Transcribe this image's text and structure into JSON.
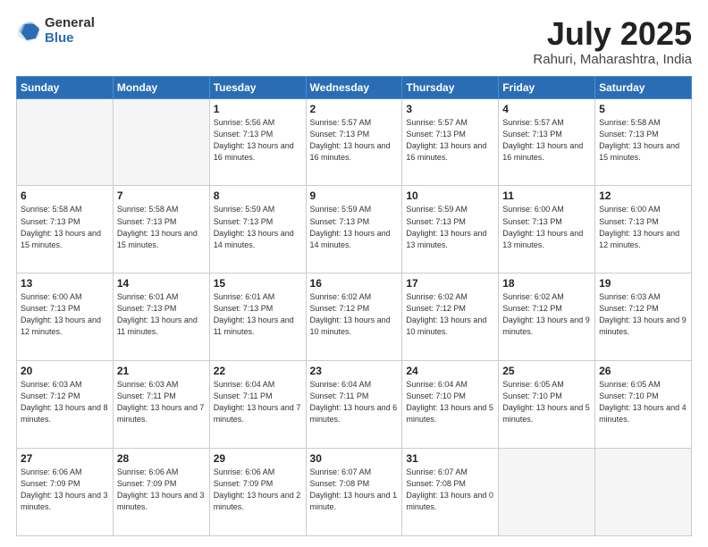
{
  "header": {
    "logo_general": "General",
    "logo_blue": "Blue",
    "title": "July 2025",
    "location": "Rahuri, Maharashtra, India"
  },
  "weekdays": [
    "Sunday",
    "Monday",
    "Tuesday",
    "Wednesday",
    "Thursday",
    "Friday",
    "Saturday"
  ],
  "weeks": [
    [
      {
        "day": "",
        "info": ""
      },
      {
        "day": "",
        "info": ""
      },
      {
        "day": "1",
        "info": "Sunrise: 5:56 AM\nSunset: 7:13 PM\nDaylight: 13 hours\nand 16 minutes."
      },
      {
        "day": "2",
        "info": "Sunrise: 5:57 AM\nSunset: 7:13 PM\nDaylight: 13 hours\nand 16 minutes."
      },
      {
        "day": "3",
        "info": "Sunrise: 5:57 AM\nSunset: 7:13 PM\nDaylight: 13 hours\nand 16 minutes."
      },
      {
        "day": "4",
        "info": "Sunrise: 5:57 AM\nSunset: 7:13 PM\nDaylight: 13 hours\nand 16 minutes."
      },
      {
        "day": "5",
        "info": "Sunrise: 5:58 AM\nSunset: 7:13 PM\nDaylight: 13 hours\nand 15 minutes."
      }
    ],
    [
      {
        "day": "6",
        "info": "Sunrise: 5:58 AM\nSunset: 7:13 PM\nDaylight: 13 hours\nand 15 minutes."
      },
      {
        "day": "7",
        "info": "Sunrise: 5:58 AM\nSunset: 7:13 PM\nDaylight: 13 hours\nand 15 minutes."
      },
      {
        "day": "8",
        "info": "Sunrise: 5:59 AM\nSunset: 7:13 PM\nDaylight: 13 hours\nand 14 minutes."
      },
      {
        "day": "9",
        "info": "Sunrise: 5:59 AM\nSunset: 7:13 PM\nDaylight: 13 hours\nand 14 minutes."
      },
      {
        "day": "10",
        "info": "Sunrise: 5:59 AM\nSunset: 7:13 PM\nDaylight: 13 hours\nand 13 minutes."
      },
      {
        "day": "11",
        "info": "Sunrise: 6:00 AM\nSunset: 7:13 PM\nDaylight: 13 hours\nand 13 minutes."
      },
      {
        "day": "12",
        "info": "Sunrise: 6:00 AM\nSunset: 7:13 PM\nDaylight: 13 hours\nand 12 minutes."
      }
    ],
    [
      {
        "day": "13",
        "info": "Sunrise: 6:00 AM\nSunset: 7:13 PM\nDaylight: 13 hours\nand 12 minutes."
      },
      {
        "day": "14",
        "info": "Sunrise: 6:01 AM\nSunset: 7:13 PM\nDaylight: 13 hours\nand 11 minutes."
      },
      {
        "day": "15",
        "info": "Sunrise: 6:01 AM\nSunset: 7:13 PM\nDaylight: 13 hours\nand 11 minutes."
      },
      {
        "day": "16",
        "info": "Sunrise: 6:02 AM\nSunset: 7:12 PM\nDaylight: 13 hours\nand 10 minutes."
      },
      {
        "day": "17",
        "info": "Sunrise: 6:02 AM\nSunset: 7:12 PM\nDaylight: 13 hours\nand 10 minutes."
      },
      {
        "day": "18",
        "info": "Sunrise: 6:02 AM\nSunset: 7:12 PM\nDaylight: 13 hours\nand 9 minutes."
      },
      {
        "day": "19",
        "info": "Sunrise: 6:03 AM\nSunset: 7:12 PM\nDaylight: 13 hours\nand 9 minutes."
      }
    ],
    [
      {
        "day": "20",
        "info": "Sunrise: 6:03 AM\nSunset: 7:12 PM\nDaylight: 13 hours\nand 8 minutes."
      },
      {
        "day": "21",
        "info": "Sunrise: 6:03 AM\nSunset: 7:11 PM\nDaylight: 13 hours\nand 7 minutes."
      },
      {
        "day": "22",
        "info": "Sunrise: 6:04 AM\nSunset: 7:11 PM\nDaylight: 13 hours\nand 7 minutes."
      },
      {
        "day": "23",
        "info": "Sunrise: 6:04 AM\nSunset: 7:11 PM\nDaylight: 13 hours\nand 6 minutes."
      },
      {
        "day": "24",
        "info": "Sunrise: 6:04 AM\nSunset: 7:10 PM\nDaylight: 13 hours\nand 5 minutes."
      },
      {
        "day": "25",
        "info": "Sunrise: 6:05 AM\nSunset: 7:10 PM\nDaylight: 13 hours\nand 5 minutes."
      },
      {
        "day": "26",
        "info": "Sunrise: 6:05 AM\nSunset: 7:10 PM\nDaylight: 13 hours\nand 4 minutes."
      }
    ],
    [
      {
        "day": "27",
        "info": "Sunrise: 6:06 AM\nSunset: 7:09 PM\nDaylight: 13 hours\nand 3 minutes."
      },
      {
        "day": "28",
        "info": "Sunrise: 6:06 AM\nSunset: 7:09 PM\nDaylight: 13 hours\nand 3 minutes."
      },
      {
        "day": "29",
        "info": "Sunrise: 6:06 AM\nSunset: 7:09 PM\nDaylight: 13 hours\nand 2 minutes."
      },
      {
        "day": "30",
        "info": "Sunrise: 6:07 AM\nSunset: 7:08 PM\nDaylight: 13 hours\nand 1 minute."
      },
      {
        "day": "31",
        "info": "Sunrise: 6:07 AM\nSunset: 7:08 PM\nDaylight: 13 hours\nand 0 minutes."
      },
      {
        "day": "",
        "info": ""
      },
      {
        "day": "",
        "info": ""
      }
    ]
  ]
}
